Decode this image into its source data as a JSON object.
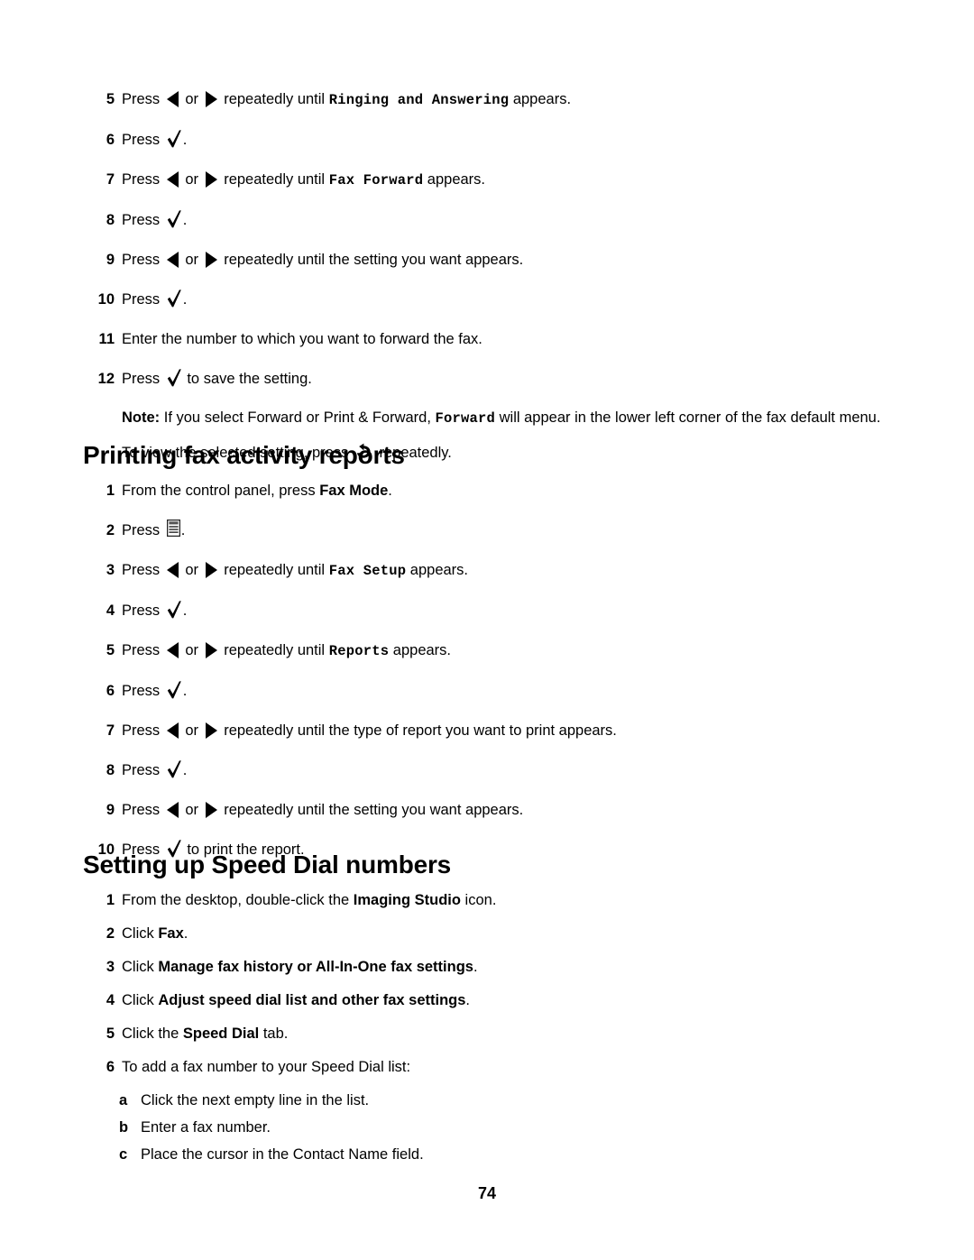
{
  "document": {
    "page_number": "74",
    "text_color": "#000000",
    "background_color": "#ffffff"
  },
  "icons": {
    "left_arrow": "left-arrow-icon",
    "right_arrow": "right-arrow-icon",
    "check": "checkmark-icon",
    "back": "back-arrow-icon",
    "menu": "menu-icon"
  },
  "section_continued": {
    "steps": [
      {
        "num": "5",
        "pre": "Press ",
        "mid": " or ",
        "post": " repeatedly until ",
        "code": "Ringing and Answering",
        "tail": " appears.",
        "icons": [
          "left_arrow",
          "right_arrow"
        ]
      },
      {
        "num": "6",
        "pre": "Press ",
        "tail": ".",
        "icons": [
          "check"
        ]
      },
      {
        "num": "7",
        "pre": "Press ",
        "mid": " or ",
        "post": " repeatedly until  ",
        "code": "Fax Forward",
        "tail": " appears.",
        "icons": [
          "left_arrow",
          "right_arrow"
        ]
      },
      {
        "num": "8",
        "pre": "Press ",
        "tail": ".",
        "icons": [
          "check"
        ]
      },
      {
        "num": "9",
        "pre": "Press ",
        "mid": " or ",
        "post": " repeatedly until the setting you want appears.",
        "icons": [
          "left_arrow",
          "right_arrow"
        ]
      },
      {
        "num": "10",
        "pre": "Press ",
        "tail": ".",
        "icons": [
          "check"
        ]
      },
      {
        "num": "11",
        "pre": "Enter the number to which you want to forward the fax."
      },
      {
        "num": "12",
        "pre": "Press ",
        "tail": " to save the setting.",
        "icons": [
          "check"
        ]
      }
    ],
    "note": {
      "label": "Note:",
      "line1_a": " If you select Forward or Print & Forward, ",
      "line1_code": "Forward",
      "line1_b": " will appear in the lower left corner of the fax default menu.",
      "line2_a": "To view the selected setting, press ",
      "line2_b": " repeatedly."
    }
  },
  "section_reports": {
    "title": "Printing fax activity reports",
    "steps": [
      {
        "num": "1",
        "pre": "From the control panel, press ",
        "bold": "Fax Mode",
        "tail": "."
      },
      {
        "num": "2",
        "pre": "Press ",
        "tail": ".",
        "icons": [
          "menu"
        ]
      },
      {
        "num": "3",
        "pre": "Press ",
        "mid": " or ",
        "post": " repeatedly until ",
        "code": "Fax Setup",
        "tail": " appears.",
        "icons": [
          "left_arrow",
          "right_arrow"
        ]
      },
      {
        "num": "4",
        "pre": "Press ",
        "tail": ".",
        "icons": [
          "check"
        ]
      },
      {
        "num": "5",
        "pre": "Press ",
        "mid": " or ",
        "post": " repeatedly until ",
        "code": "Reports",
        "tail": " appears.",
        "icons": [
          "left_arrow",
          "right_arrow"
        ]
      },
      {
        "num": "6",
        "pre": "Press ",
        "tail": ".",
        "icons": [
          "check"
        ]
      },
      {
        "num": "7",
        "pre": "Press ",
        "mid": " or ",
        "post": " repeatedly until the type of report you want to print appears.",
        "icons": [
          "left_arrow",
          "right_arrow"
        ]
      },
      {
        "num": "8",
        "pre": "Press ",
        "tail": ".",
        "icons": [
          "check"
        ]
      },
      {
        "num": "9",
        "pre": "Press ",
        "mid": " or ",
        "post": " repeatedly until the setting you want appears.",
        "icons": [
          "left_arrow",
          "right_arrow"
        ]
      },
      {
        "num": "10",
        "pre": "Press ",
        "tail": " to print the report.",
        "icons": [
          "check"
        ]
      }
    ]
  },
  "section_speed_dial": {
    "title": "Setting up Speed Dial numbers",
    "steps": [
      {
        "num": "1",
        "pre": "From the desktop, double-click the ",
        "bold": "Imaging Studio",
        "tail": " icon."
      },
      {
        "num": "2",
        "pre": "Click ",
        "bold": "Fax",
        "tail": "."
      },
      {
        "num": "3",
        "pre": "Click ",
        "bold": "Manage fax history or All-In-One fax settings",
        "tail": "."
      },
      {
        "num": "4",
        "pre": "Click ",
        "bold": "Adjust speed dial list and other fax settings",
        "tail": "."
      },
      {
        "num": "5",
        "pre": "Click the ",
        "bold": "Speed Dial",
        "tail": " tab."
      },
      {
        "num": "6",
        "pre": "To add a fax number to your Speed Dial list:"
      }
    ],
    "substeps": [
      {
        "letter": "a",
        "text": "Click the next empty line in the list."
      },
      {
        "letter": "b",
        "text": "Enter a fax number."
      },
      {
        "letter": "c",
        "text": "Place the cursor in the Contact Name field."
      }
    ]
  }
}
